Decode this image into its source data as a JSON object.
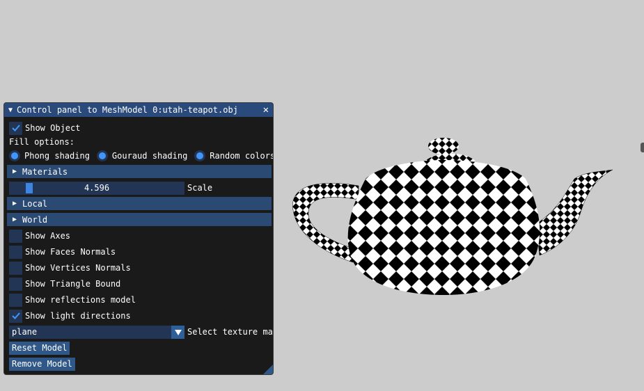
{
  "panel": {
    "title": "Control panel to MeshModel 0:utah-teapot.obj",
    "show_object": {
      "label": "Show Object",
      "checked": true
    },
    "fill_options_label": "Fill options:",
    "fill_modes": [
      {
        "label": "Phong shading",
        "selected": false
      },
      {
        "label": "Gouraud shading",
        "selected": false
      },
      {
        "label": "Random colors",
        "selected": false
      }
    ],
    "headers": {
      "materials": "Materials",
      "local": "Local",
      "world": "World"
    },
    "scale": {
      "value": "4.596",
      "label": "Scale",
      "fraction": 0.1
    },
    "checkboxes": [
      {
        "label": "Show Axes",
        "checked": false
      },
      {
        "label": "Show Faces Normals",
        "checked": false
      },
      {
        "label": "Show Vertices Normals",
        "checked": false
      },
      {
        "label": "Show Triangle Bound",
        "checked": false
      },
      {
        "label": "Show reflections model",
        "checked": false
      },
      {
        "label": "Show light directions",
        "checked": true
      }
    ],
    "texture": {
      "value": "plane",
      "label": "Select texture ma"
    },
    "buttons": {
      "reset": "Reset Model",
      "remove": "Remove Model"
    }
  },
  "colors": {
    "background": "#cccccc",
    "panel": "#1a1a1a",
    "title": "#294a7a",
    "accent": "#4296fa"
  },
  "icons": {
    "collapse": "triangle-down-icon",
    "close": "close-icon",
    "expand": "triangle-right-icon",
    "check": "checkmark-icon",
    "combo": "chevron-down-icon"
  }
}
